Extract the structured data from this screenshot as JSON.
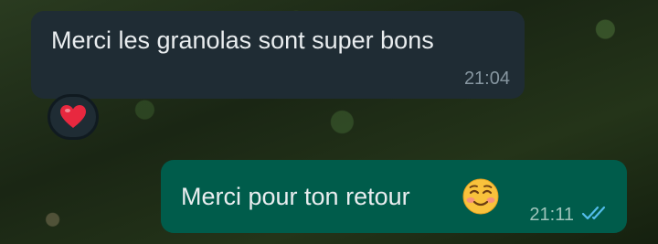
{
  "messages": [
    {
      "direction": "incoming",
      "text": "Merci les granolas sont super bons",
      "time": "21:04",
      "reaction": "heart"
    },
    {
      "direction": "outgoing",
      "text": "Merci pour ton retour",
      "emoji": "smiling-face",
      "time": "21:11",
      "status": "read"
    }
  ],
  "colors": {
    "incoming_bubble": "#1f2c34",
    "outgoing_bubble": "#005c4b",
    "read_ticks": "#53bdeb",
    "reaction_heart": "#e8283f"
  }
}
